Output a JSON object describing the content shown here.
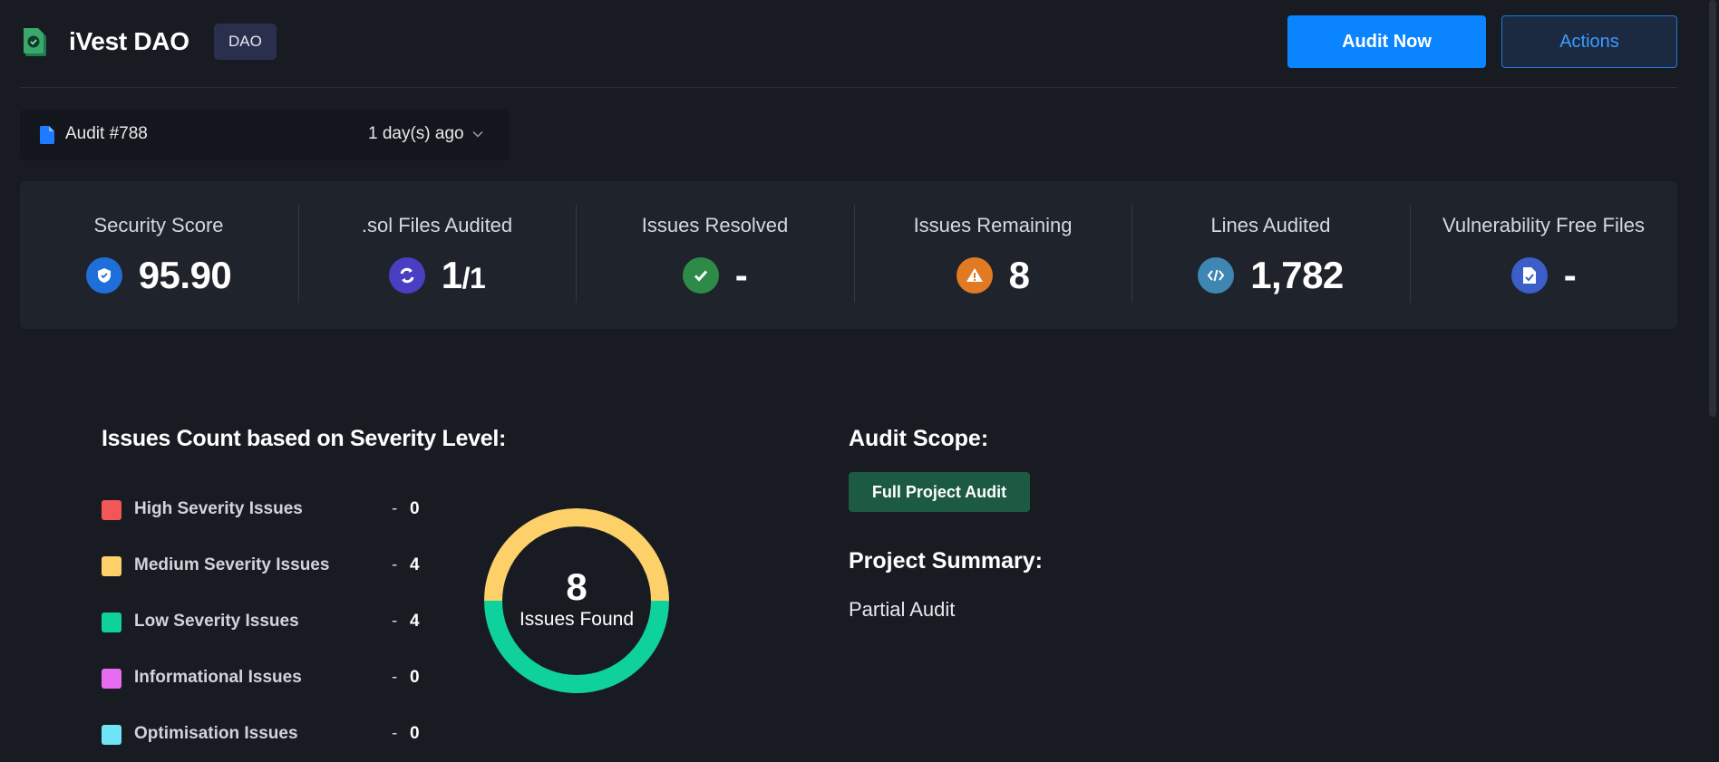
{
  "header": {
    "app_title": "iVest DAO",
    "badge": "DAO",
    "audit_now_label": "Audit Now",
    "actions_label": "Actions"
  },
  "audit_selector": {
    "audit_label": "Audit #788",
    "time_label": "1 day(s) ago"
  },
  "stats": [
    {
      "label": "Security Score",
      "value": "95.90",
      "icon": "shield-icon",
      "color": "#1e6fd9"
    },
    {
      "label": ".sol Files Audited",
      "value": "1",
      "value_suffix": "/1",
      "icon": "refresh-code-icon",
      "color": "#4a3fc4"
    },
    {
      "label": "Issues Resolved",
      "value": "-",
      "icon": "check-icon",
      "color": "#2e8b47"
    },
    {
      "label": "Issues Remaining",
      "value": "8",
      "icon": "warning-icon",
      "color": "#e07b24"
    },
    {
      "label": "Lines Audited",
      "value": "1,782",
      "icon": "code-icon",
      "color": "#3f87b3"
    },
    {
      "label": "Vulnerability Free Files",
      "value": "-",
      "icon": "file-check-icon",
      "color": "#3b5ec9"
    }
  ],
  "severity": {
    "title": "Issues Count based on Severity Level:",
    "items": [
      {
        "label": "High Severity Issues",
        "dash": "-",
        "count": "0",
        "color": "#f25757"
      },
      {
        "label": "Medium Severity Issues",
        "dash": "-",
        "count": "4",
        "color": "#fdd06a"
      },
      {
        "label": "Low Severity Issues",
        "dash": "-",
        "count": "4",
        "color": "#0fd19b"
      },
      {
        "label": "Informational Issues",
        "dash": "-",
        "count": "0",
        "color": "#e76cf2"
      },
      {
        "label": "Optimisation Issues",
        "dash": "-",
        "count": "0",
        "color": "#6fe5f7"
      }
    ]
  },
  "chart_data": {
    "type": "pie",
    "categories": [
      "High Severity Issues",
      "Medium Severity Issues",
      "Low Severity Issues",
      "Informational Issues",
      "Optimisation Issues"
    ],
    "values": [
      0,
      4,
      4,
      0,
      0
    ],
    "colors": [
      "#f25757",
      "#fdd06a",
      "#0fd19b",
      "#e76cf2",
      "#6fe5f7"
    ],
    "center_value": "8",
    "center_label": "Issues Found"
  },
  "scope": {
    "title": "Audit Scope:",
    "badge": "Full Project Audit"
  },
  "summary": {
    "title": "Project Summary:",
    "text": "Partial Audit"
  }
}
